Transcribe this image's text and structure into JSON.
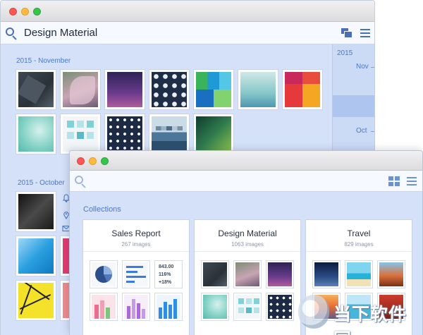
{
  "back_window": {
    "title": "Design Material",
    "sections": [
      {
        "label": "2015 - November",
        "thumb_count": 12
      },
      {
        "label": "2015 - October"
      }
    ],
    "timeline": {
      "year": "2015",
      "months": [
        "Nov",
        "Oct"
      ]
    }
  },
  "front_window": {
    "heading": "Collections",
    "collections": [
      {
        "title": "Sales Report",
        "count": "267 images",
        "stats": [
          "843.00",
          "116%",
          "+18%"
        ]
      },
      {
        "title": "Design Material",
        "count": "1063 images"
      },
      {
        "title": "Travel",
        "count": "829 images"
      }
    ]
  },
  "watermark": {
    "text": "当下软件园"
  },
  "colors": {
    "accent": "#4a79c9",
    "window_bg": "#d4e1f8",
    "toolbar_bg": "#f6f9ff",
    "traffic_red": "#fc5753",
    "traffic_yellow": "#fdbc40",
    "traffic_green": "#33c748"
  },
  "icons": [
    "search-icon",
    "stack-icon",
    "menu-icon",
    "grid-icon",
    "bell-icon",
    "pin-icon",
    "mail-icon"
  ]
}
